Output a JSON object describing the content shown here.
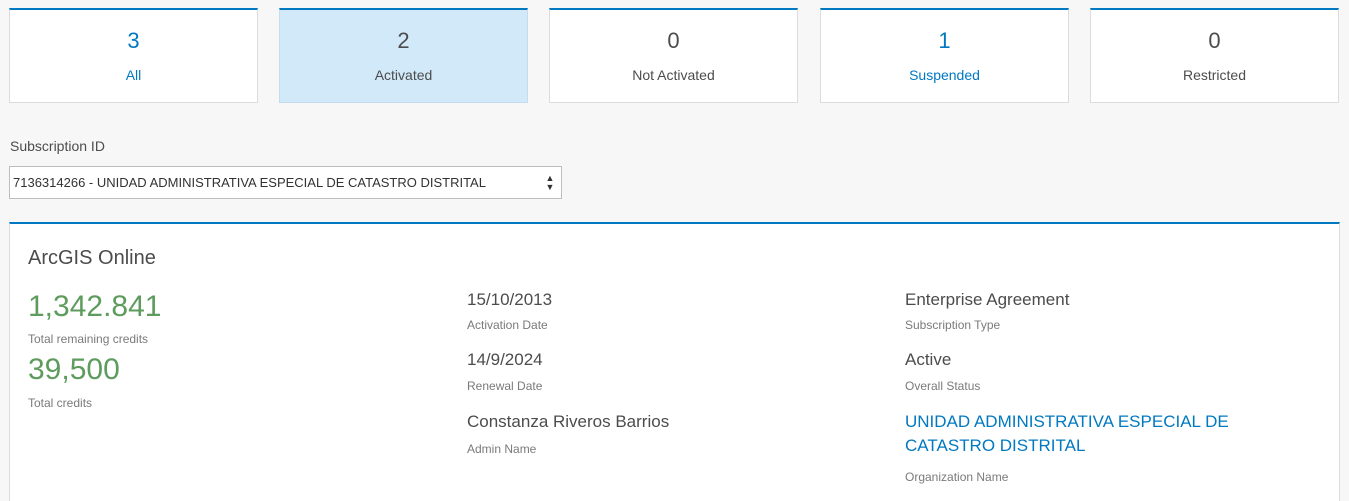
{
  "tiles": [
    {
      "count": "3",
      "label": "All"
    },
    {
      "count": "2",
      "label": "Activated"
    },
    {
      "count": "0",
      "label": "Not Activated"
    },
    {
      "count": "1",
      "label": "Suspended"
    },
    {
      "count": "0",
      "label": "Restricted"
    }
  ],
  "subscription": {
    "label": "Subscription ID",
    "selected": "7136314266 - UNIDAD ADMINISTRATIVA ESPECIAL DE CATASTRO DISTRITAL"
  },
  "card": {
    "title": "ArcGIS Online",
    "remaining_credits": "1,342.841",
    "remaining_credits_label": "Total remaining credits",
    "total_credits": "39,500",
    "total_credits_label": "Total credits",
    "activation_date": "15/10/2013",
    "activation_date_label": "Activation Date",
    "renewal_date": "14/9/2024",
    "renewal_date_label": "Renewal Date",
    "admin_name": "Constanza Riveros Barrios",
    "admin_name_label": "Admin Name",
    "subscription_type": "Enterprise Agreement",
    "subscription_type_label": "Subscription Type",
    "overall_status": "Active",
    "overall_status_label": "Overall Status",
    "organization_name": "UNIDAD ADMINISTRATIVA ESPECIAL DE CATASTRO DISTRITAL",
    "organization_name_label": "Organization Name"
  },
  "colors": {
    "accent": "#0079c1",
    "credits": "#5e9c5e",
    "active_tile": "#d2e9f9"
  }
}
